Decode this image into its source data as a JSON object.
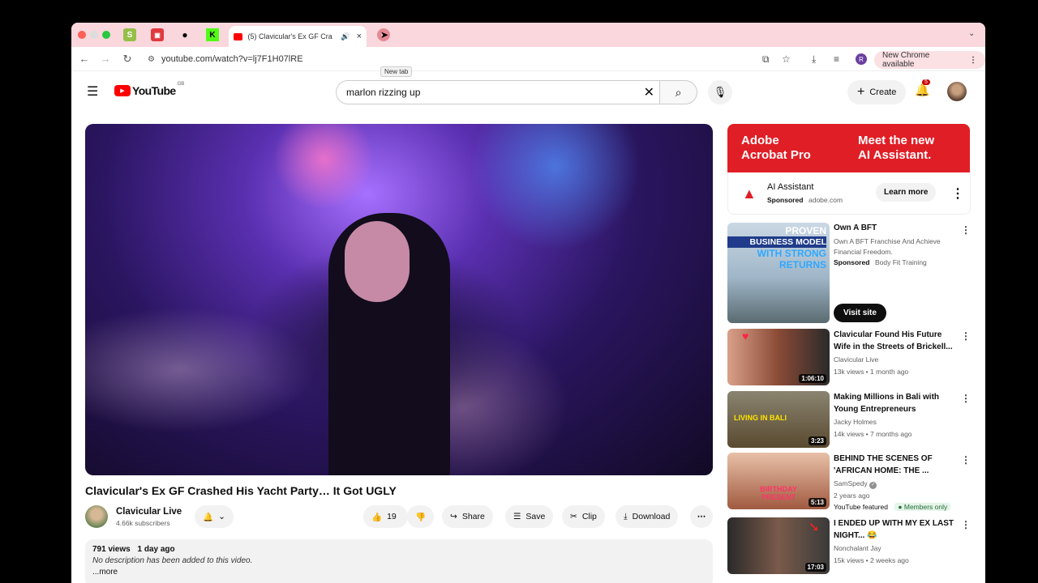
{
  "browser": {
    "active_tab": "(5) Clavicular's Ex GF Cra",
    "tooltip": "New tab",
    "url": "youtube.com/watch?v=lj7F1H07lRE",
    "profile_initial": "R",
    "new_chrome": "New Chrome available"
  },
  "youtube": {
    "logo": "YouTube",
    "region": "GB",
    "search_query": "marlon rizzing up",
    "create": "Create",
    "notif_count": "5"
  },
  "video": {
    "title": "Clavicular's Ex GF Crashed His Yacht Party… It Got UGLY",
    "channel": "Clavicular Live",
    "subscribers": "4.66k subscribers",
    "likes": "19",
    "share": "Share",
    "save": "Save",
    "clip": "Clip",
    "download": "Download",
    "views": "791 views",
    "date": "1 day ago",
    "description": "No description has been added to this video.",
    "more": "...more"
  },
  "ad": {
    "banner_left_1": "Adobe",
    "banner_left_2": "Acrobat Pro",
    "banner_right_1": "Meet the new",
    "banner_right_2": "AI Assistant.",
    "name": "AI Assistant",
    "sponsored": "Sponsored",
    "domain": "adobe.com",
    "cta": "Learn more"
  },
  "promo": {
    "title": "Own A BFT",
    "desc": "Own A BFT Franchise And Achieve Financial Freedom.",
    "sponsored": "Sponsored",
    "advertiser": "Body Fit Training",
    "cta": "Visit site",
    "thumb_text_1": "PROVEN",
    "thumb_text_2": "BUSINESS MODEL",
    "thumb_text_3": "WITH STRONG",
    "thumb_text_4": "RETURNS"
  },
  "recommendations": [
    {
      "title": "Clavicular Found His Future Wife in the Streets of Brickell...",
      "channel": "Clavicular Live",
      "meta": "13k views • 1 month ago",
      "duration": "1:06:10",
      "thumb_color": "#b85a3c"
    },
    {
      "title": "Making Millions in Bali with Young Entrepreneurs",
      "channel": "Jacky Holmes",
      "meta": "14k views • 7 months ago",
      "duration": "3:23",
      "thumb_color": "#6a5a3a",
      "thumb_text": "LIVING IN BALI"
    },
    {
      "title": "BEHIND THE SCENES OF 'AFRICAN HOME: THE ...",
      "channel": "SamSpedy",
      "meta": "2 years ago",
      "extra": "YouTube featured",
      "badge": "Members only",
      "duration": "5:13",
      "thumb_color": "#d89070",
      "thumb_text": "BIRTHDAY PRESENT"
    },
    {
      "title": "I ENDED UP WITH MY EX LAST NIGHT... 😂",
      "channel": "Nonchalant Jay",
      "meta": "15k views • 2 weeks ago",
      "duration": "17:03",
      "thumb_color": "#3a3a3a"
    }
  ]
}
